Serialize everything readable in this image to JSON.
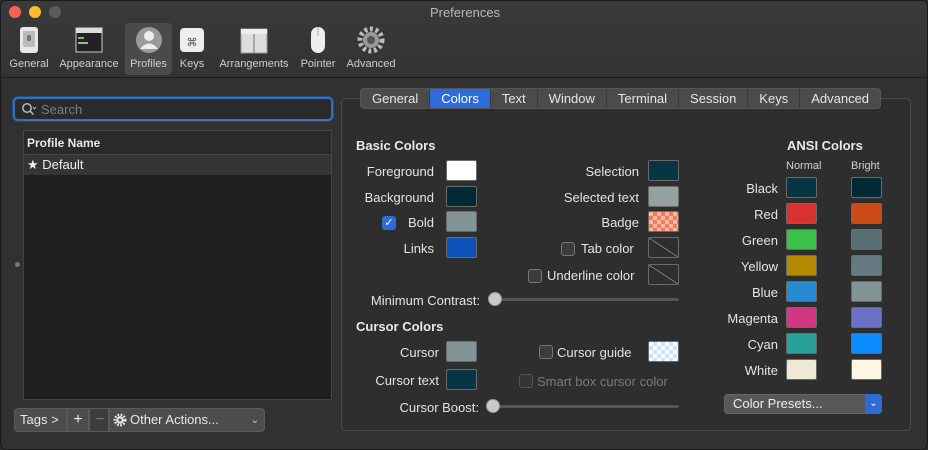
{
  "window": {
    "title": "Preferences"
  },
  "toolbar": {
    "items": [
      {
        "label": "General",
        "icon": "general-icon"
      },
      {
        "label": "Appearance",
        "icon": "appearance-icon"
      },
      {
        "label": "Profiles",
        "icon": "profiles-icon"
      },
      {
        "label": "Keys",
        "icon": "keys-icon"
      },
      {
        "label": "Arrangements",
        "icon": "arrangements-icon"
      },
      {
        "label": "Pointer",
        "icon": "pointer-icon"
      },
      {
        "label": "Advanced",
        "icon": "advanced-gear-icon"
      }
    ],
    "active": "Profiles"
  },
  "sidebar": {
    "search_placeholder": "Search",
    "list_header": "Profile Name",
    "profiles": [
      {
        "name": "Default",
        "icon": "star-icon"
      }
    ],
    "tags_label": "Tags >",
    "add_label": "+",
    "remove_label": "−",
    "other_actions_label": "Other Actions..."
  },
  "tabs": [
    "General",
    "Colors",
    "Text",
    "Window",
    "Terminal",
    "Session",
    "Keys",
    "Advanced"
  ],
  "active_tab": "Colors",
  "basic_colors": {
    "title": "Basic Colors",
    "foreground": {
      "label": "Foreground",
      "color": "#ffffff"
    },
    "background": {
      "label": "Background",
      "color": "#002b36"
    },
    "bold": {
      "label": "Bold",
      "color": "#839496",
      "checked": true
    },
    "links": {
      "label": "Links",
      "color": "#0b53b8"
    },
    "selection": {
      "label": "Selection",
      "color": "#073642"
    },
    "selected_text": {
      "label": "Selected text",
      "color": "#93a1a1"
    },
    "badge": {
      "label": "Badge",
      "color": "#f07b62"
    },
    "tab_color": {
      "label": "Tab color",
      "checked": false
    },
    "underline_color": {
      "label": "Underline color",
      "checked": false
    },
    "minimum_contrast": {
      "label": "Minimum Contrast:",
      "value": 0
    }
  },
  "cursor_colors": {
    "title": "Cursor Colors",
    "cursor": {
      "label": "Cursor",
      "color": "#839496"
    },
    "cursor_text": {
      "label": "Cursor text",
      "color": "#073642"
    },
    "cursor_guide": {
      "label": "Cursor guide",
      "checked": false,
      "color": "#c6e5ff"
    },
    "smart_box": {
      "label": "Smart box cursor color",
      "checked": false,
      "enabled": false
    },
    "cursor_boost": {
      "label": "Cursor Boost:",
      "value": 0
    }
  },
  "ansi": {
    "title": "ANSI Colors",
    "normal_header": "Normal",
    "bright_header": "Bright",
    "rows": [
      {
        "name": "Black",
        "normal": "#073642",
        "bright": "#002b36"
      },
      {
        "name": "Red",
        "normal": "#dc322f",
        "bright": "#cb4b16"
      },
      {
        "name": "Green",
        "normal": "#3cc14c",
        "bright": "#586e75"
      },
      {
        "name": "Yellow",
        "normal": "#b58900",
        "bright": "#657b83"
      },
      {
        "name": "Blue",
        "normal": "#268bd2",
        "bright": "#839496"
      },
      {
        "name": "Magenta",
        "normal": "#d33682",
        "bright": "#6c71c4"
      },
      {
        "name": "Cyan",
        "normal": "#2aa198",
        "bright": "#0a8cff"
      },
      {
        "name": "White",
        "normal": "#eee8d5",
        "bright": "#fdf6e3"
      }
    ],
    "presets_label": "Color Presets..."
  },
  "colors": {
    "accent": "#2d6cd6",
    "window_bg": "#313131"
  }
}
